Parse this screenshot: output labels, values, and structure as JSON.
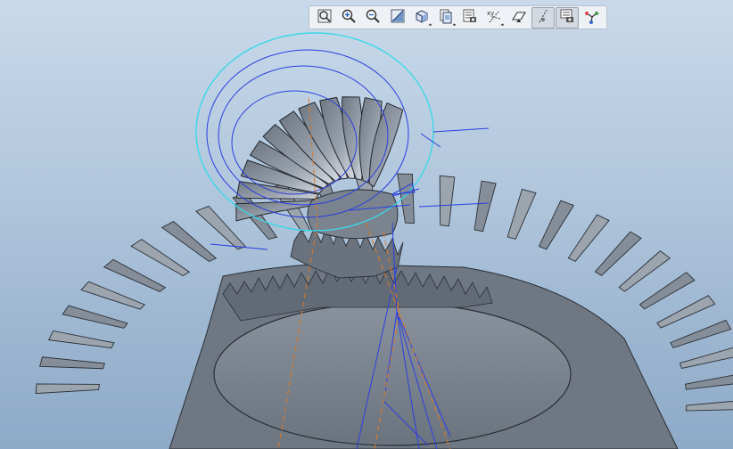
{
  "toolbar": {
    "buttons": [
      {
        "id": "refit",
        "icon": "refit-zoom-icon",
        "active": false
      },
      {
        "id": "zoom-in",
        "icon": "zoom-in-icon",
        "active": false
      },
      {
        "id": "zoom-out",
        "icon": "zoom-out-icon",
        "active": false
      },
      {
        "id": "repaint",
        "icon": "repaint-icon",
        "active": false
      },
      {
        "id": "display-style",
        "icon": "shaded-cube-icon",
        "active": false,
        "dropdown": true
      },
      {
        "id": "saved-views",
        "icon": "saved-orientations-icon",
        "active": false,
        "dropdown": true
      },
      {
        "id": "view-manager",
        "icon": "view-manager-icon",
        "active": false
      },
      {
        "id": "perspective",
        "icon": "datum-display-icon",
        "active": false,
        "dropdown": true
      },
      {
        "id": "sketch-view",
        "icon": "plane-display-icon",
        "active": false
      },
      {
        "id": "axis-display",
        "icon": "axis-display-icon",
        "active": true
      },
      {
        "id": "point-display",
        "icon": "point-display-icon",
        "active": true
      },
      {
        "id": "csys-display",
        "icon": "csys-display-icon",
        "active": false
      }
    ]
  },
  "colors": {
    "background_top": "#c9d9ea",
    "background_bottom": "#8eaac8",
    "gear_face": "#77808c",
    "gear_dark": "#525a66",
    "gear_light": "#a9b1bc",
    "datum_orange": "#d97b2a",
    "sketch_blue": "#2a3fe0",
    "highlight_cyan": "#3cd7e8"
  }
}
